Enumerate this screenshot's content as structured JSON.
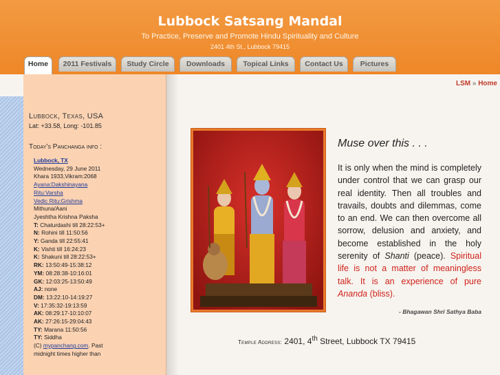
{
  "header": {
    "title": "Lubbock Satsang Mandal",
    "tagline": "To Practice, Preserve and Promote Hindu Spirituality and Culture",
    "address": "2401 4th St., Lubbock 79415"
  },
  "tabs": [
    {
      "label": "Home",
      "active": true
    },
    {
      "label": "2011 Festivals"
    },
    {
      "label": "Study Circle"
    },
    {
      "label": "Downloads"
    },
    {
      "label": "Topical Links"
    },
    {
      "label": "Contact Us"
    },
    {
      "label": "Pictures"
    }
  ],
  "sidebar": {
    "location": "Lubbock, Texas, USA",
    "coords": "Lat: +33.58, Long: -101.85",
    "panchanga_title": "Today's Panchanga info :",
    "lines": {
      "place": "Lubbock, TX",
      "date": "Wednesday, 29 June 2011",
      "era": "Khara 1933,Vikram:2068",
      "ayana": "Ayana:Dakshinayana",
      "ritu": "Ritu:Varsha",
      "vedic_ritu": "Vedic Ritu:Grishma",
      "month": "Mithuna/Aani",
      "paksha": "Jyeshtha Krishna Paksha",
      "t_label": "T:",
      "t_val": "Chaturdashi till 28:22:53+",
      "n_label": "N:",
      "n_val": "Rohini till 11:50:56",
      "y_label": "Y:",
      "y_val": "Ganda till 22:55:41",
      "k1_label": "K:",
      "k1_val": "Vishti till 16:24:23",
      "k2_label": "K:",
      "k2_val": "Shakuni till 28:22:53+",
      "rk_label": "RK:",
      "rk_val": "13:50:49-15:38:12",
      "ym_label": "YM:",
      "ym_val": "08:28:38-10:16:01",
      "gk_label": "GK:",
      "gk_val": "12:03:25-13:50:49",
      "aj_label": "AJ:",
      "aj_val": "none",
      "dm_label": "DM:",
      "dm_val": "13:22:10-14:19:27",
      "v_label": "V:",
      "v_val": "17:35:32-19:13:59",
      "ak1_label": "AK:",
      "ak1_val": "08:29:17-10:10:07",
      "ak2_label": "AK:",
      "ak2_val": "27:26:15-29:04:43",
      "ty1_label": "TY:",
      "ty1_val": "Marana 11:50:56",
      "ty2_label": "TY:",
      "ty2_val": "Siddha",
      "credit_pre": "(C)",
      "credit_link": "mypanchang.com",
      "credit_post": ". Past",
      "last": "midnight times higher than"
    }
  },
  "breadcrumb": {
    "lsm": "LSM",
    "sep": "»",
    "home": "Home"
  },
  "quote": {
    "title": "Muse over this . . .",
    "p1": "It is only when the mind is completely under control that we can grasp our real identity. Then all troubles and travails, doubts and dilemmas, come to an end. We can then overcome all sorrow, delusion and anxiety, and become established in the holy serenity of ",
    "shanti": "Shanti",
    "p2": " (peace). ",
    "red1": "Spiritual life is not a matter of meaningless talk. It is an experience of pure ",
    "ananda": "Ananda",
    "red2": " (bliss).",
    "author": "- Bhagawan Shri Sathya Baba"
  },
  "temple": {
    "label": "Temple Address:",
    "pre": " 2401, 4",
    "sup": "th",
    "post": " Street, Lubbock TX 79415"
  },
  "colors": {
    "header": "#ee8728",
    "sidebar": "#fbd3b3",
    "accent_red": "#d0211a",
    "link": "#1f3a9a"
  }
}
